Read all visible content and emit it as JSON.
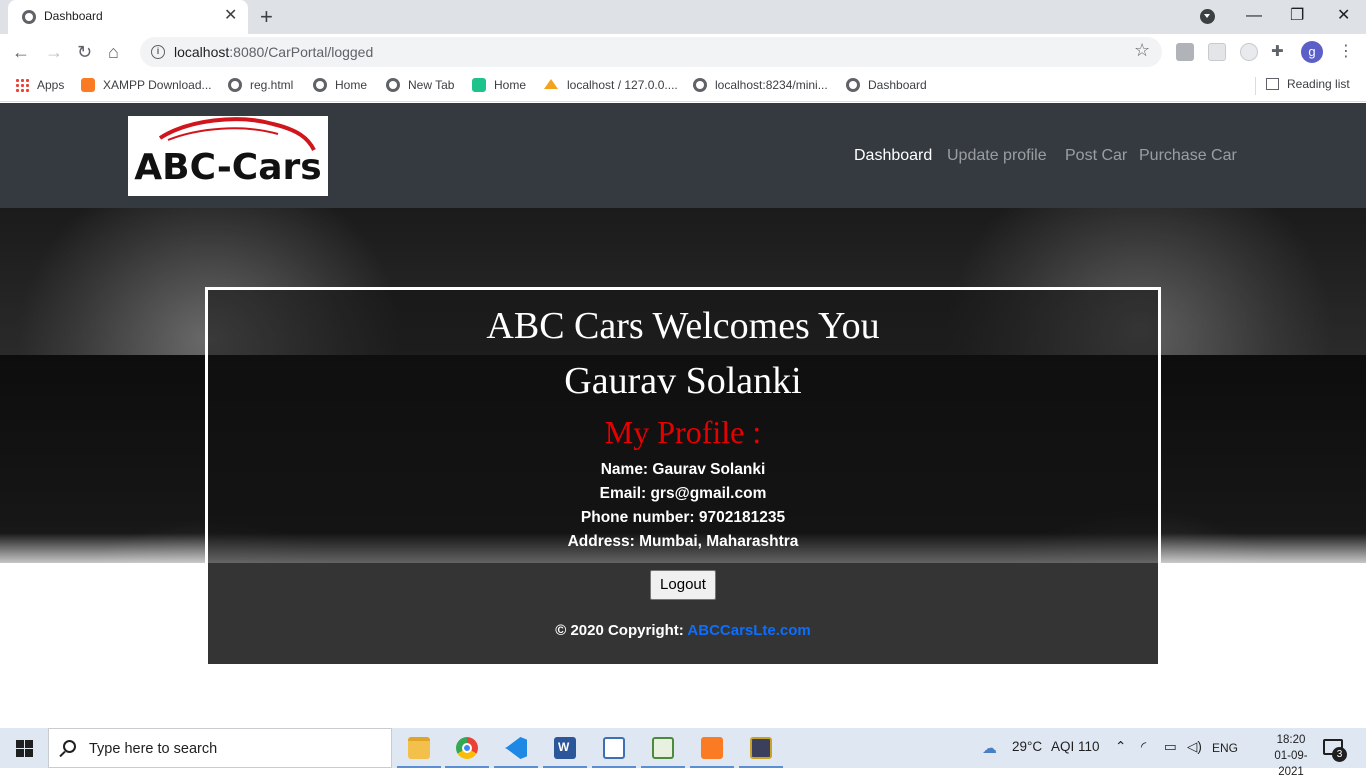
{
  "browser": {
    "tab_title": "Dashboard",
    "tab_close": "✕",
    "new_tab": "+",
    "url_host": "localhost",
    "url_rest": ":8080/CarPortal/logged",
    "profile_initial": "g",
    "win_minimize": "—",
    "win_restore": "❐",
    "win_close": "✕"
  },
  "bookmarks": [
    {
      "label": "Apps",
      "icon": "apps-grid-icon"
    },
    {
      "label": "XAMPP Download...",
      "icon": "xampp-icon"
    },
    {
      "label": "reg.html",
      "icon": "globe-icon"
    },
    {
      "label": "Home",
      "icon": "globe-icon"
    },
    {
      "label": "New Tab",
      "icon": "globe-icon"
    },
    {
      "label": "Home",
      "icon": "play-icon"
    },
    {
      "label": "localhost / 127.0.0....",
      "icon": "phpmyadmin-icon"
    },
    {
      "label": "localhost:8234/mini...",
      "icon": "globe-icon"
    },
    {
      "label": "Dashboard",
      "icon": "globe-icon"
    }
  ],
  "reading_list": "Reading list",
  "site": {
    "logo_text": "ABC-Cars",
    "nav": [
      "Dashboard",
      "Update profile",
      "Post Car",
      "Purchase Car"
    ],
    "active_nav": "Dashboard"
  },
  "card": {
    "welcome": "ABC Cars Welcomes You",
    "user_name": "Gaurav Solanki",
    "profile_title": "My Profile :",
    "name_line": "Name: Gaurav Solanki",
    "email_line": "Email: grs@gmail.com",
    "phone_line": "Phone number: 9702181235",
    "address_line": "Address: Mumbai, Maharashtra",
    "logout_label": "Logout",
    "copyright": "© 2020 Copyright: ",
    "copyright_link": "ABCCarsLte.com"
  },
  "colors": {
    "navbar_bg": "#343a40",
    "profile_title": "#e60000",
    "link": "#0d6efd"
  },
  "taskbar": {
    "search_placeholder": "Type here to search",
    "weather": "29°C",
    "aqi": "AQI 110",
    "language": "ENG",
    "time": "18:20",
    "date": "01-09-2021",
    "notification_count": "3"
  }
}
